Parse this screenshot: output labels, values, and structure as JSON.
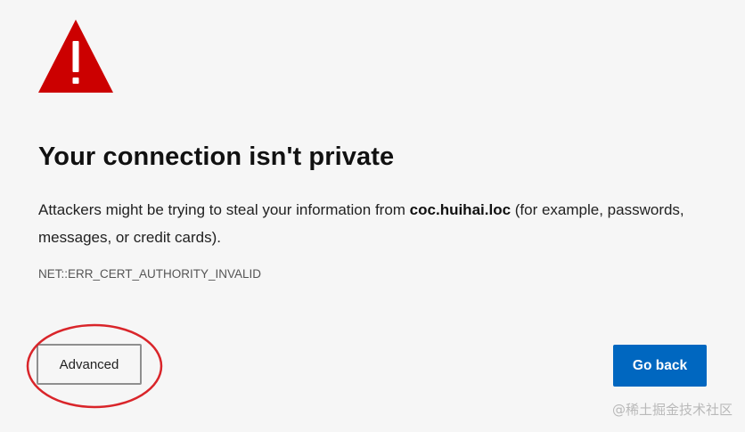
{
  "page": {
    "title": "Your connection isn't private",
    "message": {
      "before_host": "Attackers might be trying to steal your information from ",
      "host": "coc.huihai.loc",
      "after_host": " (for example, passwords, messages, or credit cards)."
    },
    "error_code": "NET::ERR_CERT_AUTHORITY_INVALID"
  },
  "buttons": {
    "advanced_label": "Advanced",
    "go_back_label": "Go back"
  },
  "watermark": "@稀土掘金技术社区",
  "icons": {
    "warning": "warning-triangle-icon"
  },
  "colors": {
    "background": "#f6f6f6",
    "warning_red": "#cc0000",
    "primary_button": "#0067c0",
    "annotation_circle": "#d9252a"
  }
}
